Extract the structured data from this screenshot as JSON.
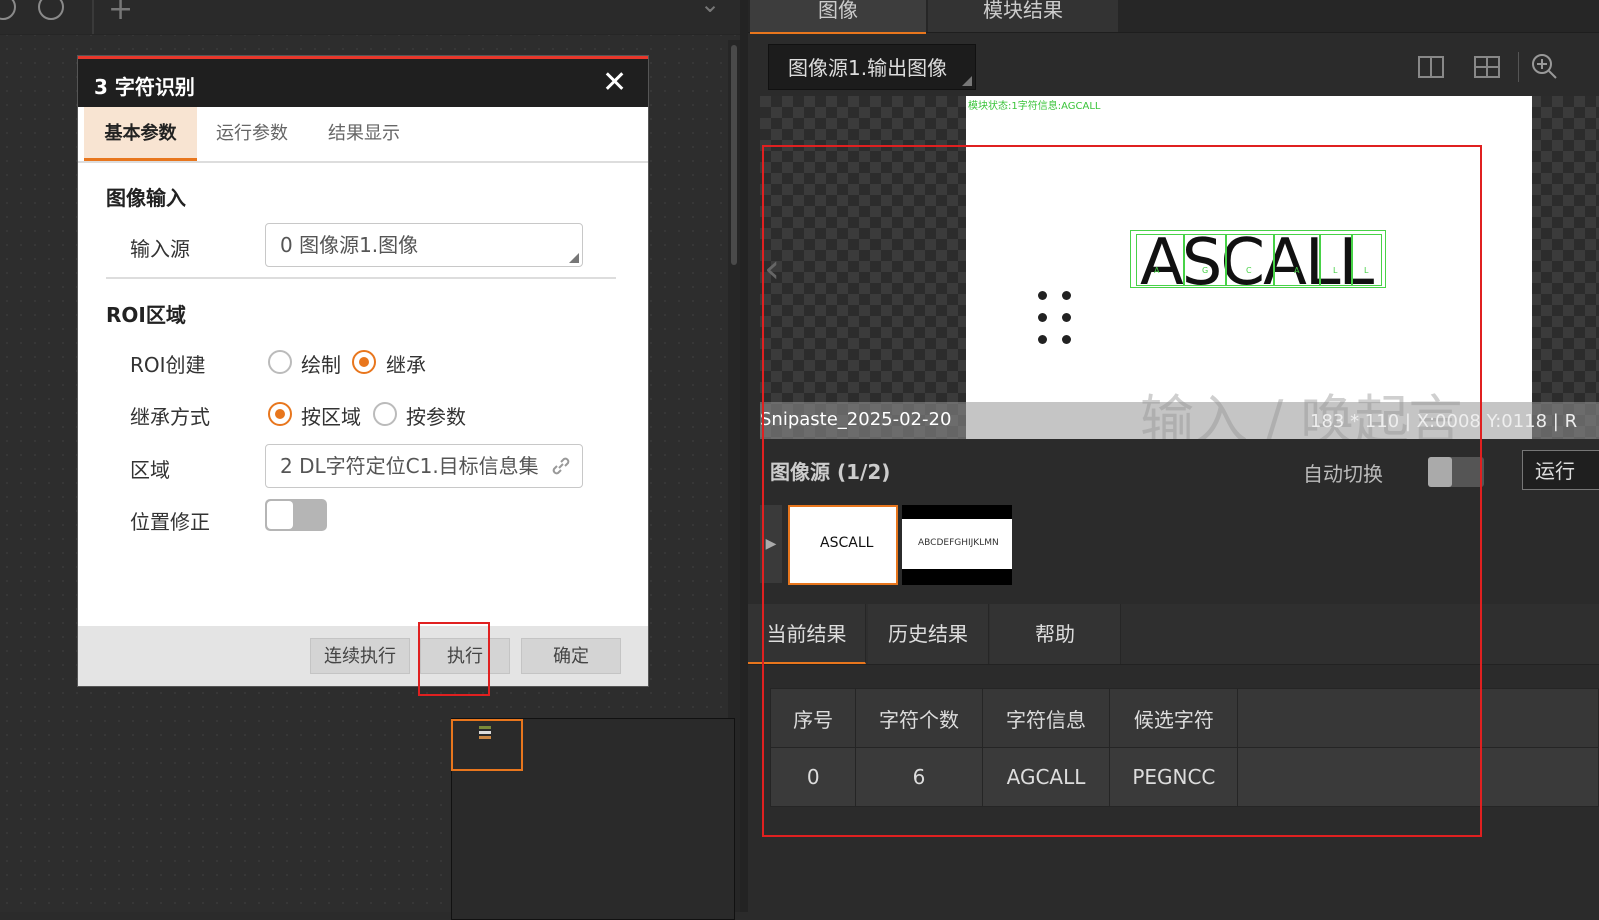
{
  "dialog": {
    "title": "3 字符识别",
    "close_icon": "✕",
    "tabs": [
      "基本参数",
      "运行参数",
      "结果显示"
    ],
    "section_image_input": "图像输入",
    "input_source_label": "输入源",
    "input_source_value": "0 图像源1.图像",
    "section_roi": "ROI区域",
    "roi_create_label": "ROI创建",
    "roi_create_options": [
      "绘制",
      "继承"
    ],
    "roi_create_selected": "继承",
    "inherit_mode_label": "继承方式",
    "inherit_mode_options": [
      "按区域",
      "按参数"
    ],
    "inherit_mode_selected": "按区域",
    "region_label": "区域",
    "region_value": "2 DL字符定位C1.目标信息集",
    "position_fix_label": "位置修正",
    "position_fix_on": false,
    "buttons": {
      "continuous": "连续执行",
      "execute": "执行",
      "confirm": "确定"
    }
  },
  "right": {
    "tabs": [
      "图像",
      "模块结果"
    ],
    "image_select": "图像源1.输出图像",
    "overlay_status": "模块状态:1字符信息:AGCALL",
    "image_text": "ASCALL",
    "char_labels": [
      "A",
      "G",
      "C",
      "A",
      "L",
      "L"
    ],
    "watermark": "输入 / 唤起言",
    "file_name": "Snipaste_2025-02-20",
    "coord_info": "183 * 110 | X:0008 Y:0118 | R",
    "image_source_title": "图像源 (1/2)",
    "auto_switch_label": "自动切换",
    "auto_switch_on": false,
    "run_button": "运行",
    "thumb1_text": "ASCALL",
    "thumb2_text": "ABCDEFGHIJKLMN",
    "result_tabs": [
      "当前结果",
      "历史结果",
      "帮助"
    ],
    "table": {
      "headers": [
        "序号",
        "字符个数",
        "字符信息",
        "候选字符",
        ""
      ],
      "rows": [
        [
          "0",
          "6",
          "AGCALL",
          "PEGNCC",
          ""
        ]
      ]
    }
  },
  "colors": {
    "accent": "#e8761d",
    "highlight": "#e02020",
    "ocr_box": "#47d247"
  }
}
